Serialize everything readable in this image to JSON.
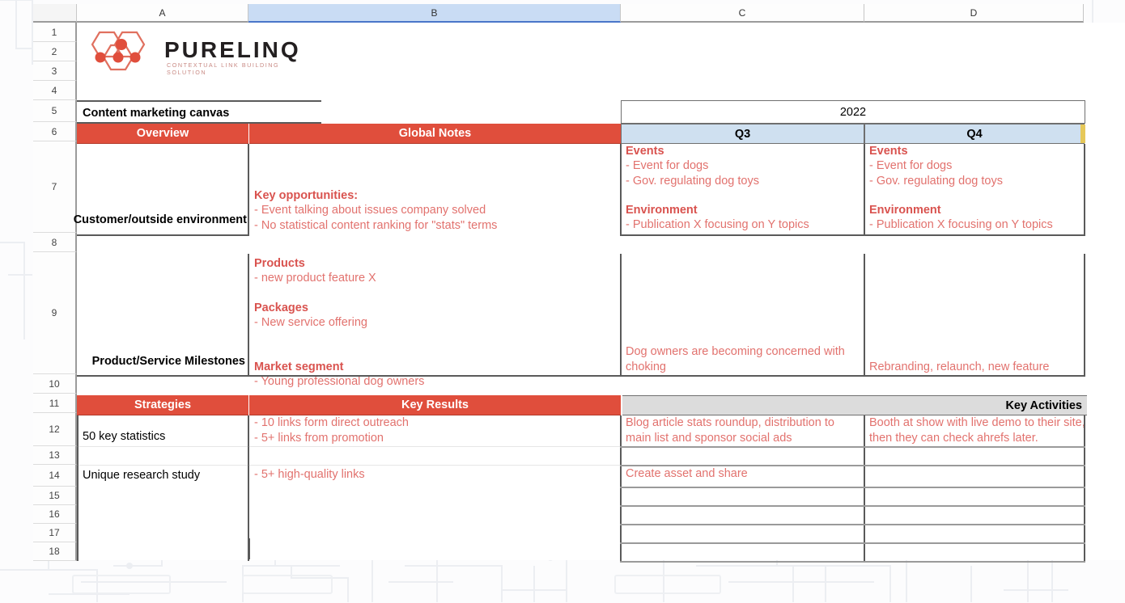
{
  "logo": {
    "brand": "PURELINQ",
    "tagline": "CONTEXTUAL LINK BUILDING SOLUTION"
  },
  "spreadsheet": {
    "column_headers": [
      "A",
      "B",
      "C",
      "D"
    ],
    "selected_column": "B",
    "row_numbers": [
      "1",
      "2",
      "3",
      "4",
      "5",
      "6",
      "7",
      "8",
      "9",
      "10",
      "11",
      "12",
      "13",
      "14",
      "15",
      "16",
      "17",
      "18"
    ]
  },
  "title": "Content marketing canvas",
  "year_header": "2022",
  "quarters": {
    "q3": "Q3",
    "q4": "Q4"
  },
  "section_one": {
    "headers": {
      "overview": "Overview",
      "global_notes": "Global Notes"
    },
    "rows": [
      {
        "label": "Customer/outside environment",
        "global_notes_title": "Key opportunities:",
        "global_notes_lines": "- Event talking about issues company solved\n- No statistical content ranking for \"stats\" terms",
        "q3_block1_title": "Events",
        "q3_block1_lines": "- Event for dogs\n- Gov. regulating dog toys",
        "q3_block2_title": "Environment",
        "q3_block2_lines": "- Publication X focusing on Y topics",
        "q4_block1_title": "Events",
        "q4_block1_lines": "- Event for dogs\n- Gov. regulating dog toys",
        "q4_block2_title": "Environment",
        "q4_block2_lines": "- Publication X focusing on Y topics"
      },
      {
        "label": "Product/Service Milestones",
        "gn_title1": "Products",
        "gn_line1": "- new product feature X",
        "gn_title2": "Packages",
        "gn_line2": "- New service offering",
        "gn_title3": "Market segment",
        "gn_line3": "- Young professional dog owners",
        "q3_text": "Dog owners are becoming concerned with choking",
        "q4_text": "Rebranding, relaunch, new feature"
      }
    ]
  },
  "section_two": {
    "headers": {
      "strategies": "Strategies",
      "key_results": "Key Results",
      "key_activities": "Key Activities"
    },
    "rows": [
      {
        "strategy": "50 key statistics",
        "key_results": "- 10 links form direct outreach\n- 5+ links from promotion",
        "q3": "Blog article stats roundup, distribution to main list and sponsor social ads",
        "q4": "Booth at show with live demo to their site, then they can check ahrefs later."
      },
      {
        "strategy": "",
        "key_results": "",
        "q3": "",
        "q4": ""
      },
      {
        "strategy": "Unique research study",
        "key_results": "- 5+ high-quality links",
        "q3": "Create asset and share",
        "q4": ""
      },
      {
        "strategy": "",
        "key_results": "",
        "q3": "",
        "q4": ""
      },
      {
        "strategy": "",
        "key_results": "",
        "q3": "",
        "q4": ""
      },
      {
        "strategy": "",
        "key_results": "",
        "q3": "",
        "q4": ""
      },
      {
        "strategy": "",
        "key_results": "",
        "q3": "",
        "q4": ""
      }
    ]
  },
  "colors": {
    "header_red": "#e04e3c",
    "quarter_blue": "#cfe0f0",
    "body_text_red": "#e2726e",
    "bold_red": "#d9534f",
    "gray_band": "#dcdcdc",
    "accent_yellow": "#e6c85a"
  }
}
